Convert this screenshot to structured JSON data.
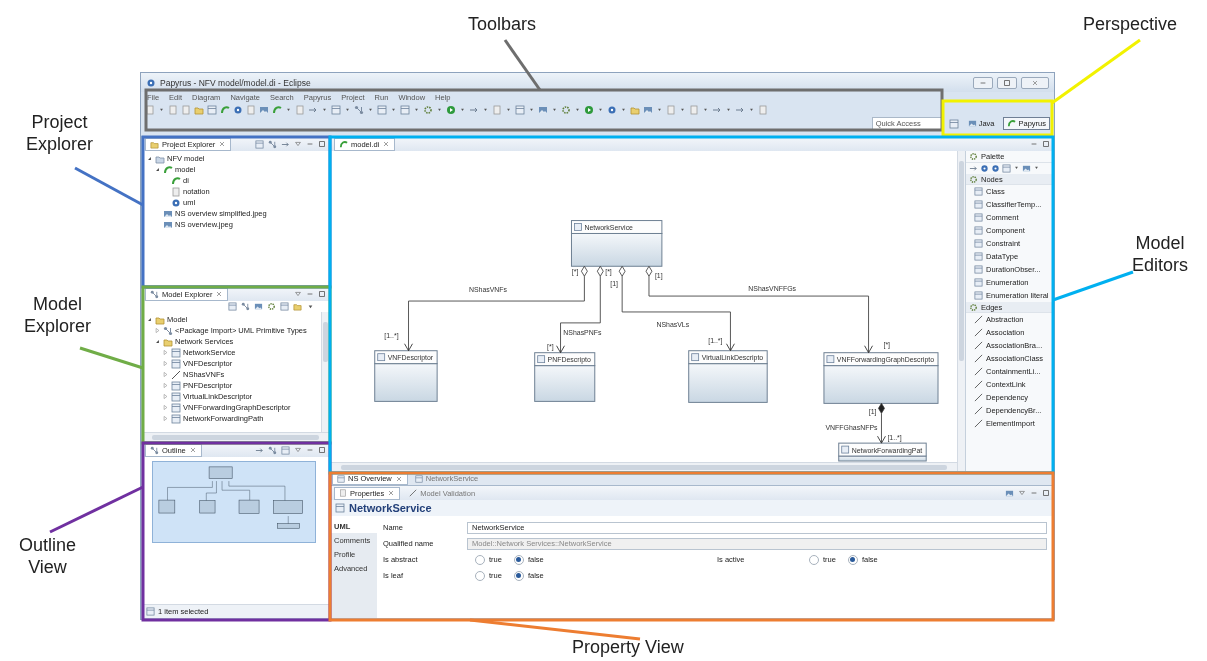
{
  "annotations": [
    {
      "label": "Toolbars",
      "color": "#6e6e6e"
    },
    {
      "label": "Perspective",
      "color": "#f2f200"
    },
    {
      "label": "Project Explorer",
      "color": "#4472c4"
    },
    {
      "label": "Model Explorer",
      "color": "#70ad47"
    },
    {
      "label": "Outline View",
      "color": "#7030a0"
    },
    {
      "label": "Model Editors",
      "color": "#00b0f0"
    },
    {
      "label": "Property View",
      "color": "#ed7d31"
    }
  ],
  "window": {
    "title": "Papyrus - NFV model/model.di - Eclipse",
    "menu": [
      "File",
      "Edit",
      "Diagram",
      "Navigate",
      "Search",
      "Papyrus",
      "Project",
      "Run",
      "Window",
      "Help"
    ],
    "quick_access": {
      "placeholder": "Quick Access"
    },
    "perspectives": [
      {
        "label": "Java",
        "selected": false
      },
      {
        "label": "Papyrus",
        "selected": true
      }
    ]
  },
  "project_explorer": {
    "title": "Project Explorer",
    "tree": [
      {
        "label": "NFV model",
        "kind": "project",
        "expanded": true,
        "children": [
          {
            "label": "model",
            "kind": "papyrus",
            "expanded": true,
            "children": [
              {
                "label": "di",
                "kind": "papyrus"
              },
              {
                "label": "notation",
                "kind": "file"
              },
              {
                "label": "uml",
                "kind": "uml"
              }
            ]
          },
          {
            "label": "NS overview simplified.jpeg",
            "kind": "image"
          },
          {
            "label": "NS overview.jpeg",
            "kind": "image"
          }
        ]
      }
    ]
  },
  "model_explorer": {
    "title": "Model Explorer",
    "tree": [
      {
        "label": "Model",
        "kind": "folder",
        "expanded": true,
        "children": [
          {
            "label": "<Package Import> UML Primitive Types",
            "kind": "import",
            "expanded": false
          },
          {
            "label": "Network Services",
            "kind": "folder",
            "expanded": true,
            "children": [
              {
                "label": "NetworkService",
                "kind": "class",
                "expanded": false
              },
              {
                "label": "VNFDescriptor",
                "kind": "class",
                "expanded": false
              },
              {
                "label": "NShasVNFs",
                "kind": "association",
                "expanded": false
              },
              {
                "label": "PNFDescriptor",
                "kind": "class",
                "expanded": false
              },
              {
                "label": "VirtualLinkDescriptor",
                "kind": "class",
                "expanded": false
              },
              {
                "label": "VNFForwardingGraphDescriptor",
                "kind": "class",
                "expanded": false
              },
              {
                "label": "NetworkForwardingPath",
                "kind": "class",
                "expanded": false
              }
            ]
          }
        ]
      }
    ]
  },
  "outline": {
    "title": "Outline",
    "status": "1 item selected"
  },
  "editor": {
    "tab": "model.di",
    "diagram": {
      "classes": [
        {
          "name": "NetworkService"
        },
        {
          "name": "VNFDescriptor"
        },
        {
          "name": "PNFDescripto"
        },
        {
          "name": "VirtualLinkDescripto"
        },
        {
          "name": "VNFForwardingGraphDescripto"
        },
        {
          "name": "NetworkForwardingPat"
        }
      ],
      "associations": [
        {
          "label": "NShasVNFs",
          "kind": "aggregation",
          "source_multiplicity": "[*]",
          "target_multiplicity": "[1..*]"
        },
        {
          "label": "NShasPNFs",
          "kind": "aggregation",
          "source_multiplicity": "[*]",
          "target_multiplicity": "[*]"
        },
        {
          "label": "NShasVLs",
          "kind": "aggregation",
          "source_multiplicity": "[1]",
          "target_multiplicity": "[1..*]"
        },
        {
          "label": "NShasVNFFGs",
          "kind": "aggregation",
          "source_multiplicity": "[1]",
          "target_multiplicity": "[*]"
        },
        {
          "label": "VNFFGhasNFPs",
          "kind": "composition",
          "source_multiplicity": "[1]",
          "target_multiplicity": "[1..*]"
        }
      ]
    },
    "palette": {
      "title": "Palette",
      "groups": [
        {
          "title": "Nodes",
          "kind": "nodes",
          "items": [
            "Class",
            "ClassifierTemp...",
            "Comment",
            "Component",
            "Constraint",
            "DataType",
            "DurationObser...",
            "Enumeration",
            "Enumeration literal"
          ]
        },
        {
          "title": "Edges",
          "kind": "edges",
          "items": [
            "Abstraction",
            "Association",
            "AssociationBra...",
            "AssociationClass",
            "ContainmentLi...",
            "ContextLink",
            "Dependency",
            "DependencyBr...",
            "ElementImport"
          ]
        }
      ]
    },
    "tabs": [
      {
        "label": "NS Overview",
        "selected": true
      },
      {
        "label": "NetworkService",
        "selected": false
      }
    ]
  },
  "properties": {
    "tabs": [
      {
        "label": "Properties",
        "selected": true
      },
      {
        "label": "Model Validation",
        "selected": false
      }
    ],
    "heading": "NetworkService",
    "side_tabs": [
      {
        "label": "UML",
        "selected": true
      },
      {
        "label": "Comments",
        "selected": false
      },
      {
        "label": "Profile",
        "selected": false
      },
      {
        "label": "Advanced",
        "selected": false
      }
    ],
    "fields": [
      {
        "label": "Name",
        "value": "NetworkService",
        "disabled": false
      },
      {
        "label": "Qualified name",
        "value": "Model::Network Services::NetworkService",
        "disabled": true
      }
    ],
    "radio_rows": [
      {
        "groups": [
          {
            "label": "Is abstract",
            "options": [
              {
                "label": "true",
                "selected": false
              },
              {
                "label": "false",
                "selected": true
              }
            ]
          },
          {
            "label": "Is active",
            "options": [
              {
                "label": "true",
                "selected": false
              },
              {
                "label": "false",
                "selected": true
              }
            ]
          }
        ]
      },
      {
        "groups": [
          {
            "label": "Is leaf",
            "options": [
              {
                "label": "true",
                "selected": false
              },
              {
                "label": "false",
                "selected": true
              }
            ]
          }
        ]
      }
    ]
  }
}
